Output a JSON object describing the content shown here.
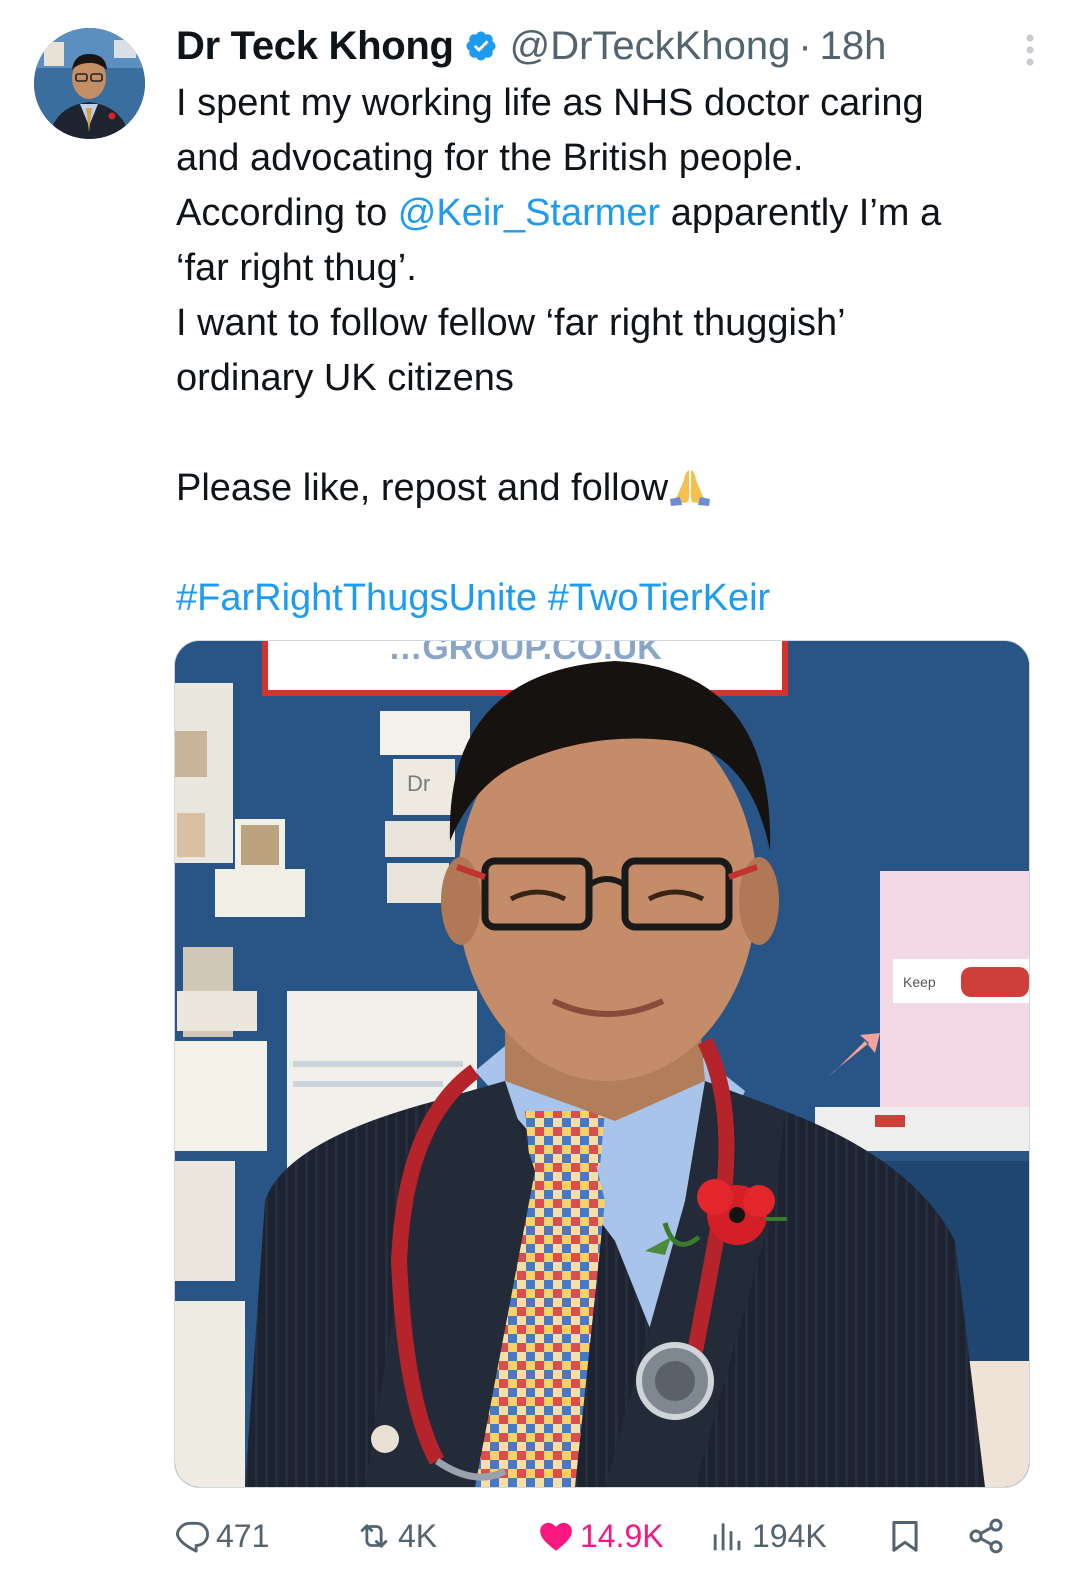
{
  "author": {
    "display_name": "Dr Teck Khong",
    "handle": "@DrTeckKhong",
    "separator": "·",
    "time_ago": "18h",
    "verified_icon": "verified-badge-icon",
    "verified_color": "#1d9bf0"
  },
  "tweet": {
    "line1": "I spent my working life as NHS doctor caring",
    "line2": "and advocating for the British people.",
    "line3_before": "According to ",
    "line3_mention": "@Keir_Starmer",
    "line3_after": " apparently I’m a",
    "line4": "‘far right thug’.",
    "line5": "I want to follow fellow ‘far right thuggish’",
    "line6": "ordinary UK citizens",
    "line7": "Please like, repost and follow",
    "emoji": "folded-hands-icon",
    "hashtag1": "#FarRightThugsUnite",
    "hashtag2": "#TwoTierKeir"
  },
  "media": {
    "board_banner_text": "…GROUP.CO.UK",
    "notice_label": "Dr",
    "sign_text": "Keep"
  },
  "actions": {
    "replies": "471",
    "reposts": "4K",
    "likes": "14.9K",
    "views": "194K",
    "liked": true,
    "like_color": "#f91880",
    "link_color": "#1d9bf0",
    "muted_color": "#536471",
    "icons": [
      "reply-icon",
      "repost-icon",
      "like-icon",
      "views-icon",
      "bookmark-icon",
      "share-icon"
    ]
  }
}
